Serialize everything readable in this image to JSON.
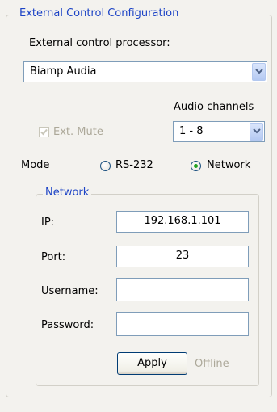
{
  "group_title": "External Control Configuration",
  "processor": {
    "label": "External control processor:",
    "selected": "Biamp Audia"
  },
  "audio_channels": {
    "label": "Audio channels",
    "selected": "1 - 8"
  },
  "ext_mute": {
    "label": "Ext. Mute",
    "checked": true,
    "enabled": false
  },
  "mode": {
    "label": "Mode",
    "options": [
      "RS-232",
      "Network"
    ],
    "selected": "Network"
  },
  "network": {
    "title": "Network",
    "ip_label": "IP:",
    "ip_value": "192.168.1.101",
    "port_label": "Port:",
    "port_value": "23",
    "username_label": "Username:",
    "username_value": "",
    "password_label": "Password:",
    "password_value": ""
  },
  "apply_label": "Apply",
  "status_text": "Offline",
  "colors": {
    "legend": "#1d44c6",
    "radio_dot": "#21a121",
    "disabled_text": "#aca899"
  }
}
